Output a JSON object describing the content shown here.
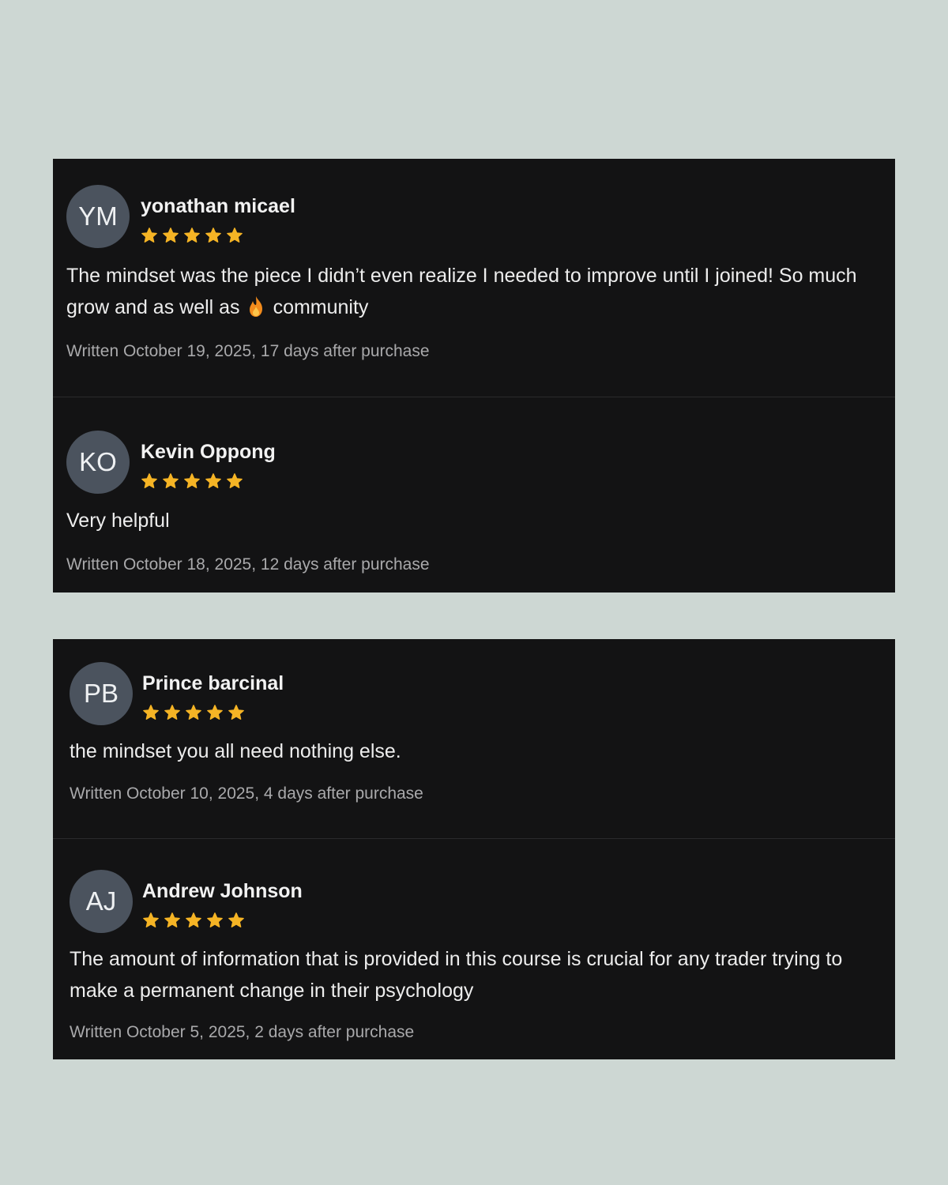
{
  "colors": {
    "page_background": "#cdd7d3",
    "card_background": "#131314",
    "avatar_background": "#4b535e",
    "star_color": "#f5b425",
    "meta_text": "#a9a9ab"
  },
  "reviews": [
    {
      "initials": "YM",
      "name": "yonathan micael",
      "rating": 5,
      "text_before_emoji": "The mindset was the piece I didn’t even realize I needed to improve until I joined! So much grow and as well as",
      "emoji": "fire-icon",
      "text_after_emoji": "community",
      "written": "Written October 19, 2025, 17 days after purchase"
    },
    {
      "initials": "KO",
      "name": "Kevin Oppong",
      "rating": 5,
      "text": "Very helpful",
      "written": "Written October 18, 2025, 12 days after purchase"
    },
    {
      "initials": "PB",
      "name": "Prince barcinal",
      "rating": 5,
      "text": "the mindset you all need nothing else.",
      "written": "Written October 10, 2025, 4 days after purchase"
    },
    {
      "initials": "AJ",
      "name": "Andrew Johnson",
      "rating": 5,
      "text": "The amount of information that is provided in this course is crucial for any trader trying to make a permanent change in their psychology",
      "written": "Written October 5, 2025, 2 days after purchase"
    }
  ]
}
